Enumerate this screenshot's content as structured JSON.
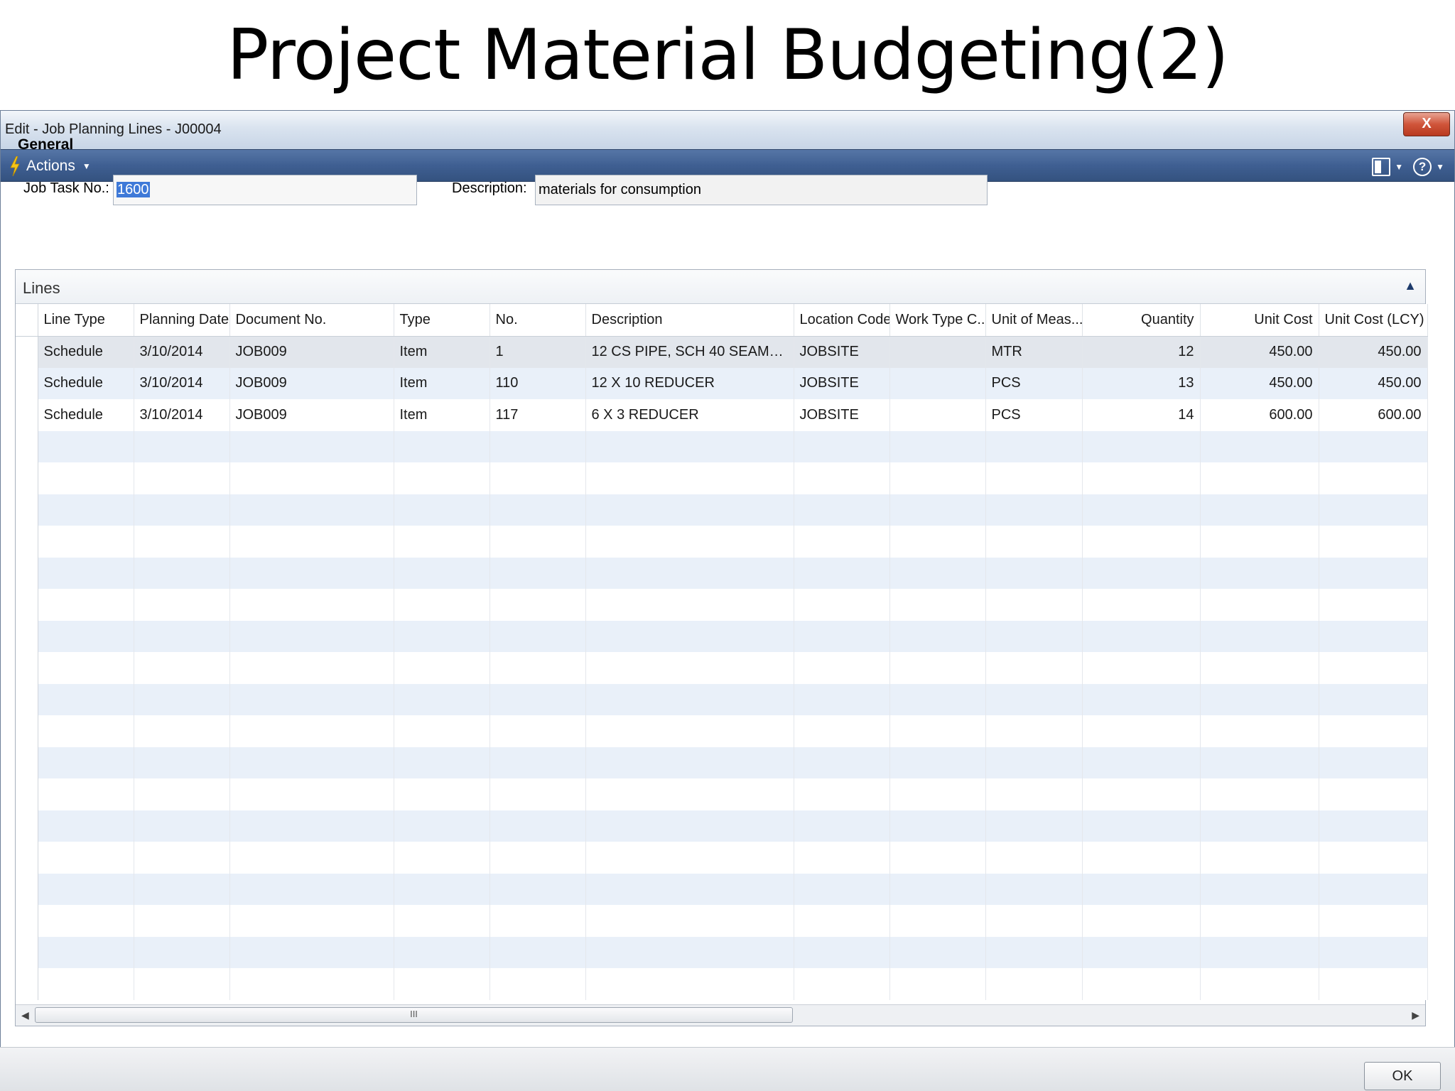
{
  "slide": {
    "title": "Project Material Budgeting(2)"
  },
  "window": {
    "title": "Edit - Job Planning Lines - J00004",
    "close_label": "X"
  },
  "actionbar": {
    "actions_label": "Actions",
    "help_label": "?"
  },
  "general": {
    "header": "General",
    "job_task_label": "Job Task No.:",
    "job_task_value": "1600",
    "description_label": "Description:",
    "description_value": "materials for consumption"
  },
  "lines": {
    "title": "Lines",
    "columns": [
      "Line Type",
      "Planning Date",
      "Document No.",
      "Type",
      "No.",
      "Description",
      "Location Code",
      "Work Type C...",
      "Unit of Meas...",
      "Quantity",
      "Unit Cost",
      "Unit Cost (LCY)"
    ],
    "rows": [
      [
        "Schedule",
        "3/10/2014",
        "JOB009",
        "Item",
        "1",
        "12 CS PIPE, SCH 40 SEAMLESS PI...",
        "JOBSITE",
        "",
        "MTR",
        "12",
        "450.00",
        "450.00"
      ],
      [
        "Schedule",
        "3/10/2014",
        "JOB009",
        "Item",
        "110",
        "12 X 10 REDUCER",
        "JOBSITE",
        "",
        "PCS",
        "13",
        "450.00",
        "450.00"
      ],
      [
        "Schedule",
        "3/10/2014",
        "JOB009",
        "Item",
        "117",
        "6 X 3 REDUCER",
        "JOBSITE",
        "",
        "PCS",
        "14",
        "600.00",
        "600.00"
      ]
    ],
    "scroll_thumb_label": "III"
  },
  "footer": {
    "ok_label": "OK"
  },
  "colors": {
    "actionbar": "#3f5f92",
    "selection": "#3e79d8",
    "row_stripe": "#e9f0f9",
    "close_button": "#d0553a"
  }
}
